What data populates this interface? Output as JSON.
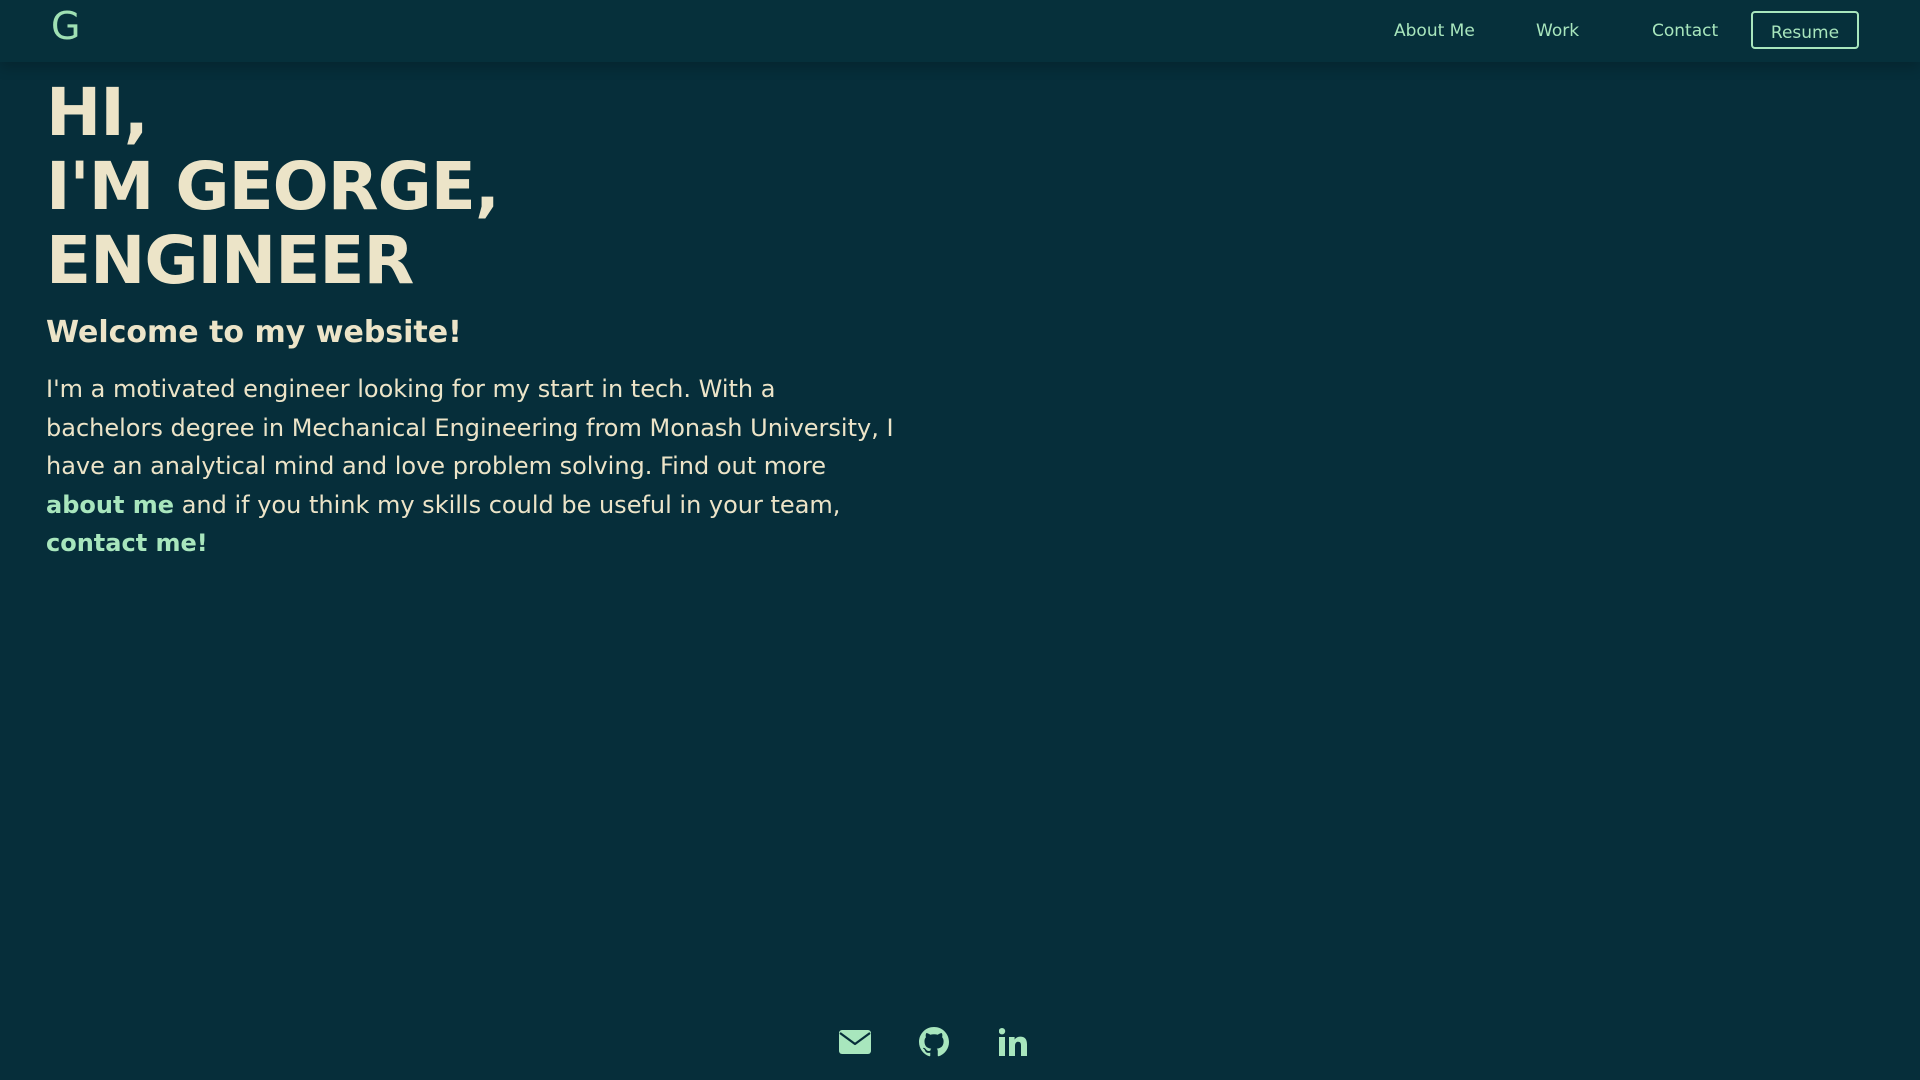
{
  "header": {
    "logo": "G",
    "nav": {
      "about": "About Me",
      "work": "Work",
      "contact": "Contact",
      "resume": "Resume"
    }
  },
  "hero": {
    "line1": "HI,",
    "line2": "I'M GEORGE,",
    "line3": "ENGINEER",
    "welcome": "Welcome to my website!",
    "intro_part1": "I'm a motivated engineer looking for my start in tech. With a bachelors degree in Mechanical Engineering from Monash University, I have an analytical mind and love problem solving. Find out more ",
    "link_about": "about me",
    "intro_part2": " and if you think my skills could be useful in your team, ",
    "link_contact": "contact me!"
  },
  "social": {
    "icons": [
      "envelope-icon",
      "github-icon",
      "linkedin-icon"
    ]
  },
  "colors": {
    "background": "#062e3a",
    "accent": "#a8e6bd",
    "text": "#ece4c8"
  }
}
